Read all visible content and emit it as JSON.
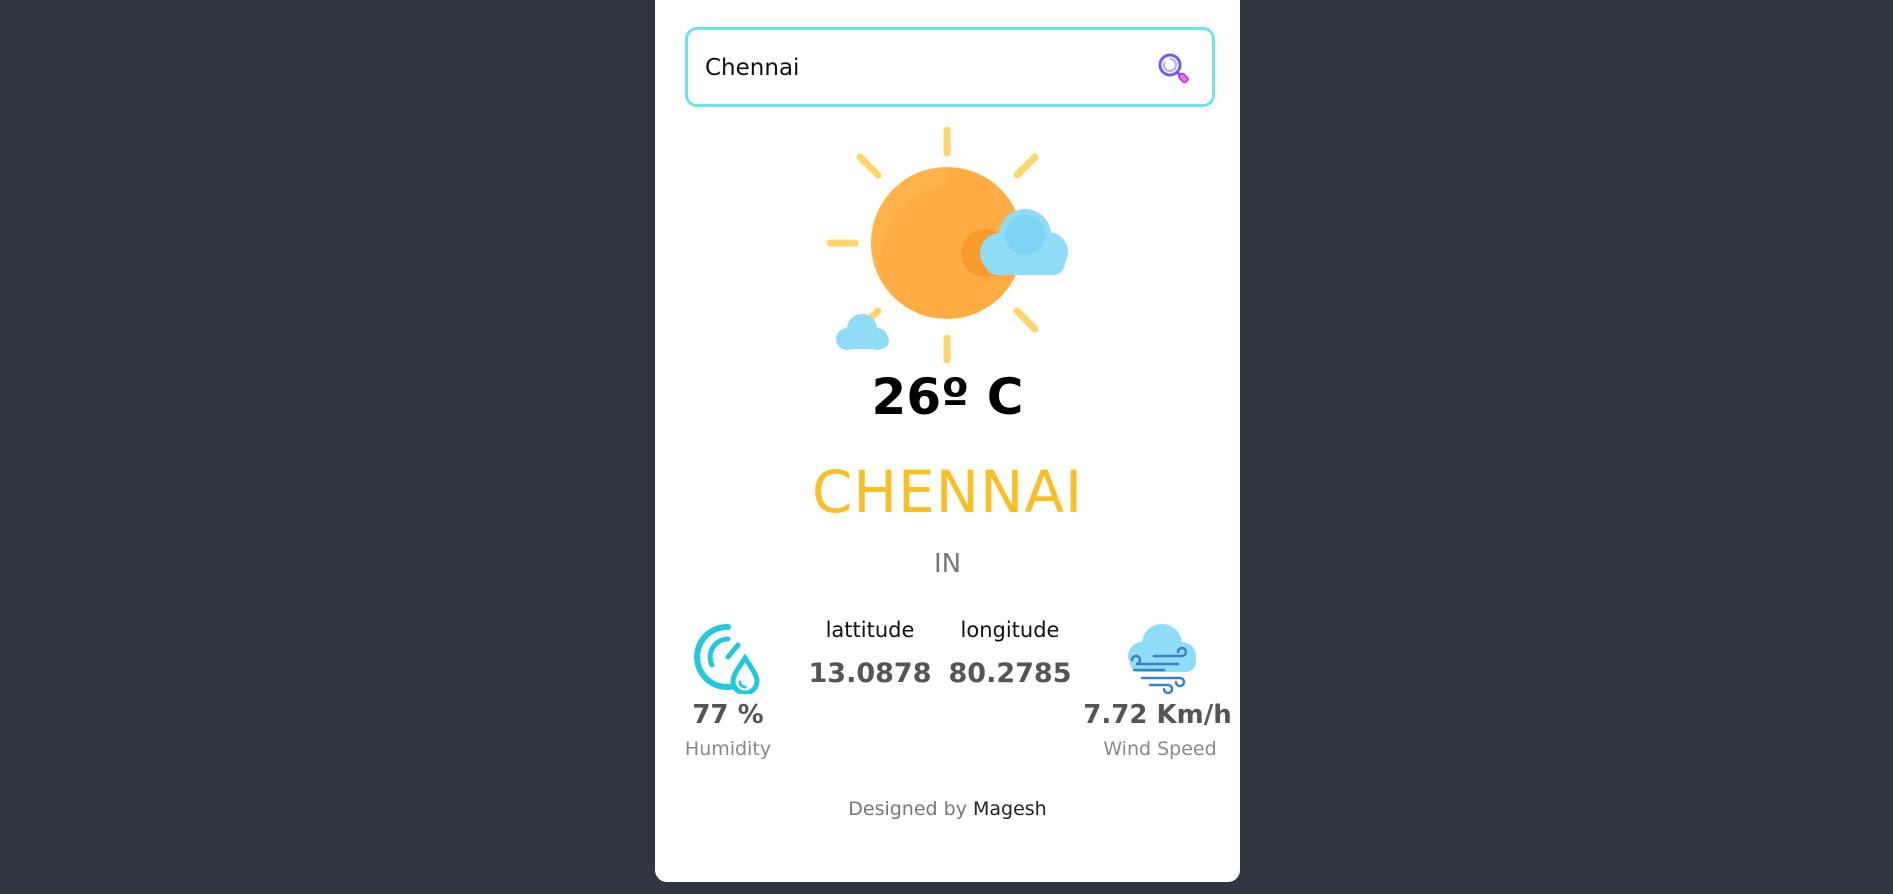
{
  "search": {
    "value": "Chennai",
    "placeholder": ""
  },
  "weather": {
    "icon": "sun-with-clouds-icon",
    "temperature": "26º C",
    "city": "CHENNAI",
    "country": "IN"
  },
  "stats": {
    "humidity_value": "77 %",
    "humidity_label": "Humidity",
    "latitude_label": "lattitude",
    "latitude_value": "13.0878",
    "longitude_label": "longitude",
    "longitude_value": "80.2785",
    "wind_value": "7.72 Km/h",
    "wind_label": "Wind Speed"
  },
  "footer": {
    "prefix": "Designed by",
    "author": "Magesh"
  },
  "colors": {
    "background": "#2f3640",
    "card": "#ffffff",
    "search_border": "#6fe2ef",
    "city": "#fbbf24",
    "sun": "#ffad42",
    "humidity_icon": "#22c8dc"
  }
}
